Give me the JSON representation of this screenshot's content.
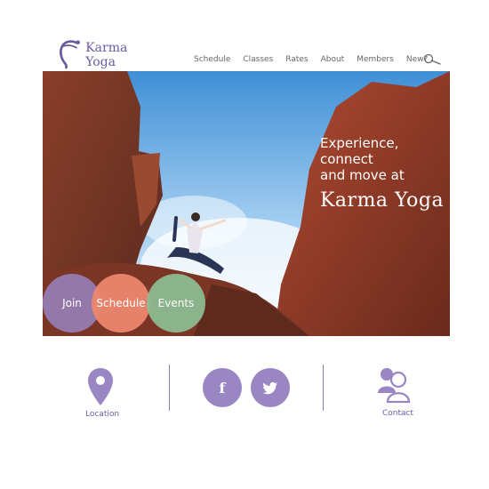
{
  "brand": {
    "name": "Karma Yoga",
    "color": "#6b5a9e"
  },
  "nav": {
    "items": [
      "Schedule",
      "Classes",
      "Rates",
      "About",
      "Members",
      "New?"
    ],
    "search_icon": "search-icon"
  },
  "hero": {
    "tagline_lines": [
      "Experience,",
      "connect",
      "and move at"
    ],
    "tagline_brand": "Karma Yoga",
    "buttons": [
      {
        "label": "Join",
        "color": "#967eb6"
      },
      {
        "label": "Schedule",
        "color": "#eb876e"
      },
      {
        "label": "Events",
        "color": "#8cbe96"
      }
    ]
  },
  "footer": {
    "location_label": "Location",
    "contact_label": "Contact",
    "social_icons": [
      "facebook-icon",
      "twitter-icon"
    ],
    "accent": "#9a86c2"
  }
}
